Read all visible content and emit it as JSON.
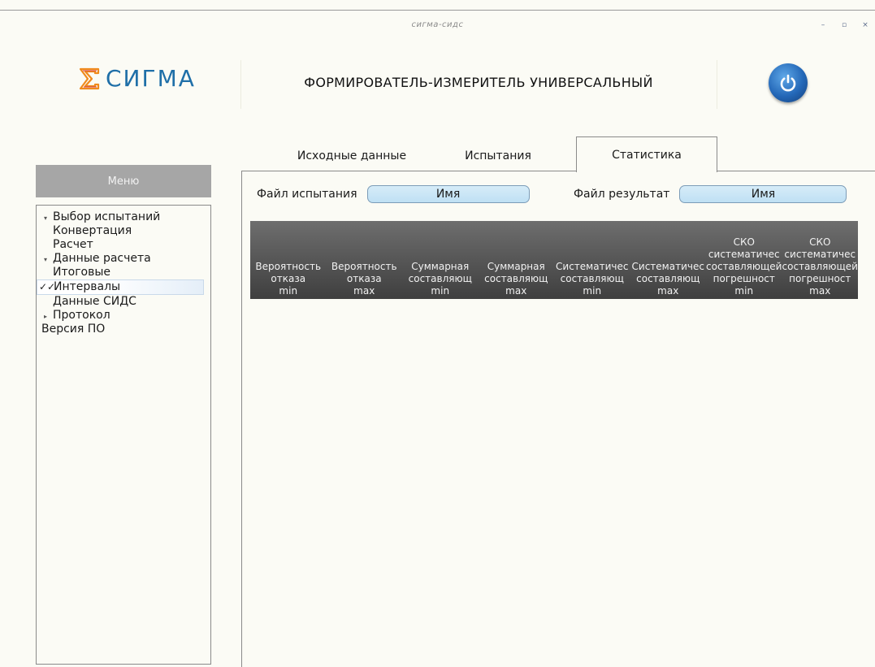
{
  "window": {
    "title": "сигма-сидс",
    "controls": [
      "–",
      "▫",
      "×"
    ]
  },
  "header": {
    "logo_text": "СИГМА",
    "app_title": "ФОРМИРОВАТЕЛЬ-ИЗМЕРИТЕЛЬ УНИВЕРСАЛЬНЫЙ",
    "power_icon": "power-icon",
    "accent_color": "#1f6fa8"
  },
  "sidebar": {
    "menu_label": "Меню",
    "items": [
      {
        "label": "Выбор испытаний",
        "arrow": "▾",
        "level": 0
      },
      {
        "label": "Конвертация",
        "level": 1
      },
      {
        "label": "Расчет",
        "level": 1
      },
      {
        "label": "Данные расчета",
        "arrow": "▾",
        "level": 0
      },
      {
        "label": "Итоговые",
        "level": 1
      },
      {
        "label": "Интервалы",
        "level": 1,
        "selected": true,
        "check": "✓✓"
      },
      {
        "label": "Данные СИДС",
        "level": 1
      },
      {
        "label": "Протокол",
        "arrow": "▸",
        "level": 0
      },
      {
        "label": "Версия ПО",
        "level": 0
      }
    ]
  },
  "tabs": [
    {
      "label": "Исходные данные",
      "active": false
    },
    {
      "label": "Испытания",
      "active": false
    },
    {
      "label": "Статистика",
      "active": true
    }
  ],
  "files": {
    "test_label": "Файл испытания",
    "test_value": "Имя",
    "result_label": "Файл результат",
    "result_value": "Имя"
  },
  "table": {
    "columns": [
      {
        "lines": [
          "Вероятность",
          "отказа",
          "min"
        ]
      },
      {
        "lines": [
          "Вероятность",
          "отказа",
          "max"
        ]
      },
      {
        "lines": [
          "Суммарная",
          "составляющ",
          "min"
        ]
      },
      {
        "lines": [
          "Суммарная",
          "составляющ",
          "max"
        ]
      },
      {
        "lines": [
          "Систематичес",
          "составляющ",
          "min"
        ]
      },
      {
        "lines": [
          "Систематичес",
          "составляющ",
          "max"
        ]
      },
      {
        "lines": [
          "СКО",
          "систематичес",
          "составляющей",
          "погрешност",
          "min"
        ]
      },
      {
        "lines": [
          "СКО",
          "систематичес",
          "составляющей",
          "погрешност",
          "max"
        ]
      }
    ],
    "rows": []
  }
}
